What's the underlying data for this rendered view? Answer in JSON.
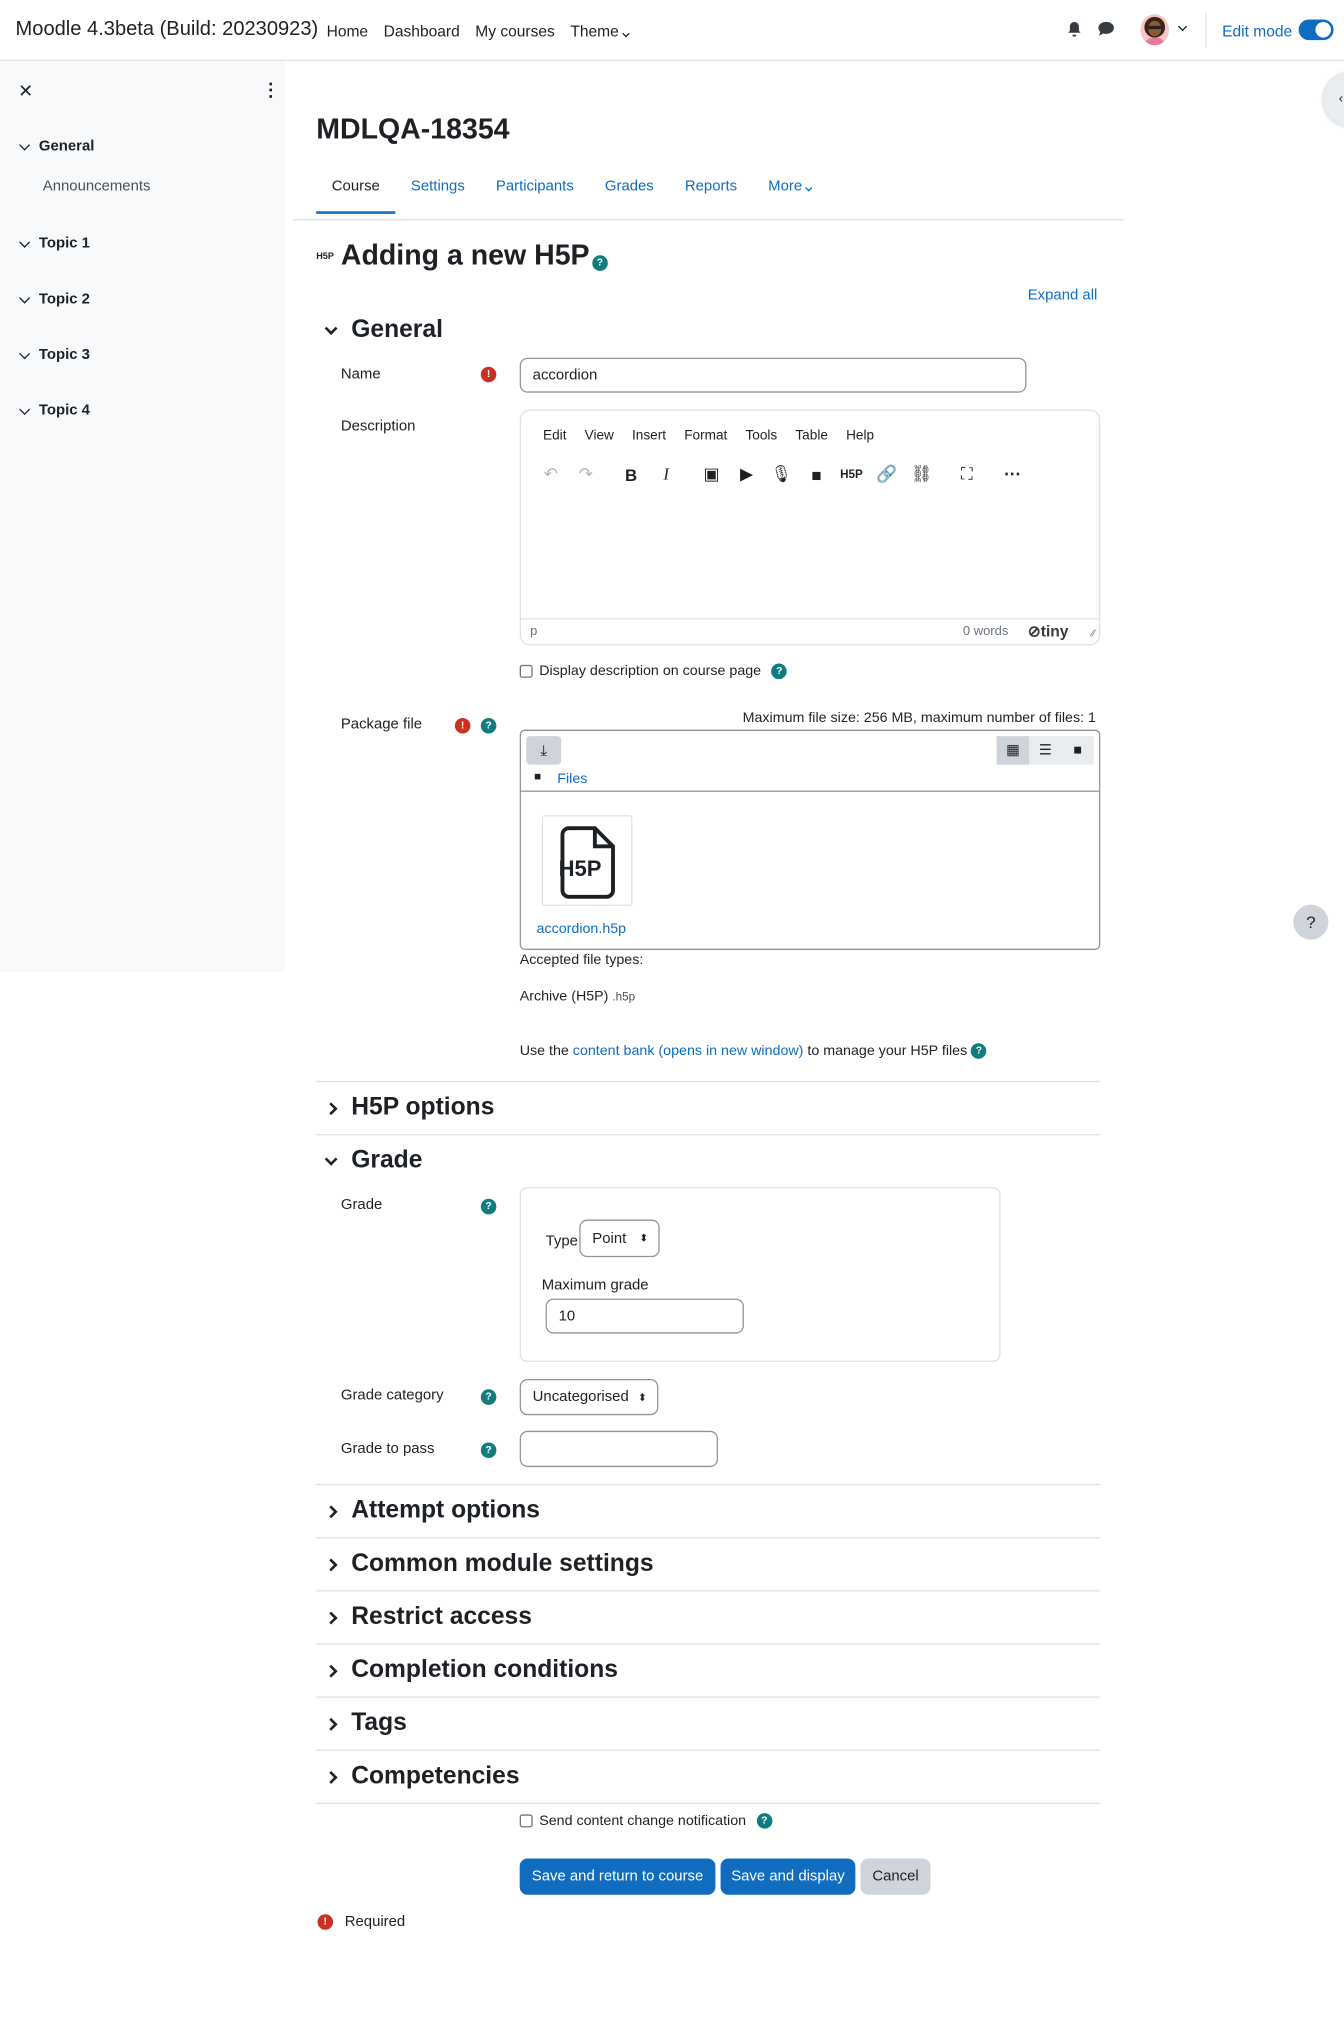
{
  "navbar": {
    "brand": "Moodle 4.3beta (Build: 20230923)",
    "links": [
      "Home",
      "Dashboard",
      "My courses",
      "Theme"
    ],
    "edit_mode_label": "Edit mode"
  },
  "drawer": {
    "items": [
      {
        "label": "General",
        "sub": "Announcements"
      },
      {
        "label": "Topic 1"
      },
      {
        "label": "Topic 2"
      },
      {
        "label": "Topic 3"
      },
      {
        "label": "Topic 4"
      }
    ]
  },
  "page": {
    "course_title": "MDLQA-18354",
    "tabs": [
      "Course",
      "Settings",
      "Participants",
      "Grades",
      "Reports",
      "More"
    ],
    "heading": "Adding a new H5P",
    "expand_all": "Expand all"
  },
  "general": {
    "title": "General",
    "name_label": "Name",
    "name_value": "accordion",
    "description_label": "Description",
    "editor_menu": [
      "Edit",
      "View",
      "Insert",
      "Format",
      "Tools",
      "Table",
      "Help"
    ],
    "editor_path": "p",
    "editor_words": "0 words",
    "editor_brand": "tiny",
    "display_desc_label": "Display description on course page",
    "package_label": "Package file",
    "max_size": "Maximum file size: 256 MB, maximum number of files: 1",
    "files_crumb": "Files",
    "file_name": "accordion.h5p",
    "accepted_label": "Accepted file types:",
    "accepted_type": "Archive (H5P)",
    "accepted_ext": ".h5p",
    "contentbank_pre": "Use the",
    "contentbank_link": "content bank (opens in new window)",
    "contentbank_post": "to manage your H5P files"
  },
  "h5p_options": {
    "title": "H5P options"
  },
  "grade": {
    "title": "Grade",
    "grade_label": "Grade",
    "type_label": "Type",
    "type_value": "Point",
    "max_grade_label": "Maximum grade",
    "max_grade_value": "10",
    "category_label": "Grade category",
    "category_value": "Uncategorised",
    "pass_label": "Grade to pass",
    "pass_value": ""
  },
  "sections": [
    "Attempt options",
    "Common module settings",
    "Restrict access",
    "Completion conditions",
    "Tags",
    "Competencies"
  ],
  "footer": {
    "notify_label": "Send content change notification",
    "save_return": "Save and return to course",
    "save_display": "Save and display",
    "cancel": "Cancel",
    "required": "Required"
  },
  "colors": {
    "primary": "#0f6cbf",
    "error": "#ca3120",
    "help": "#0f7d7d"
  }
}
